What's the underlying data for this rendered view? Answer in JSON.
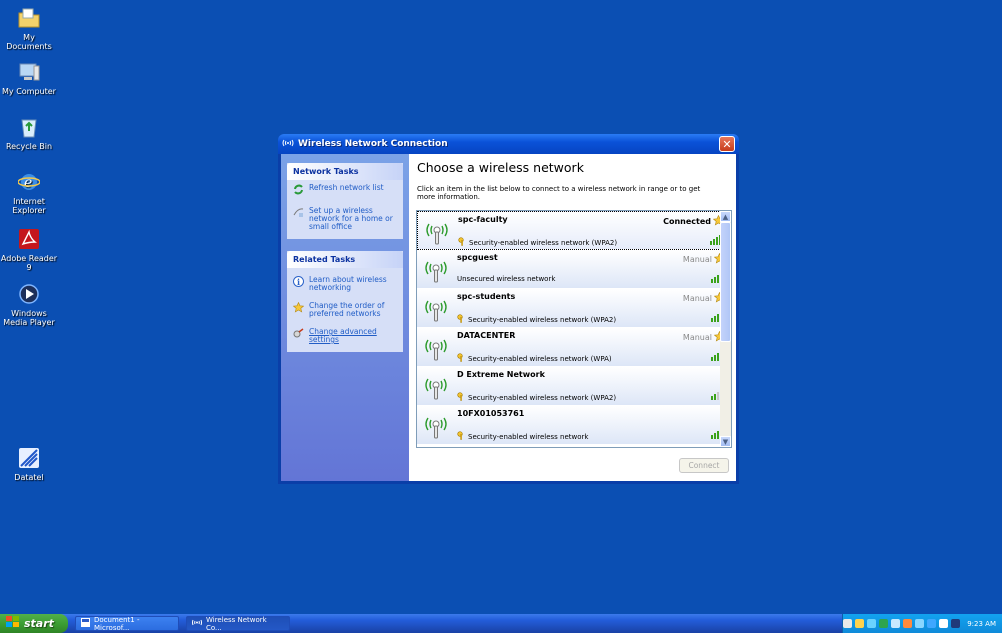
{
  "desktop": {
    "icons": [
      {
        "label": "My Documents",
        "icon": "my-documents-icon"
      },
      {
        "label": "My Computer",
        "icon": "my-computer-icon"
      },
      {
        "label": "Recycle Bin",
        "icon": "recycle-bin-icon"
      },
      {
        "label": "Internet Explorer",
        "icon": "internet-explorer-icon"
      },
      {
        "label": "Adobe Reader 9",
        "icon": "adobe-reader-icon"
      },
      {
        "label": "Windows Media Player",
        "icon": "media-player-icon"
      },
      {
        "label": "Datatel",
        "icon": "datatel-icon"
      }
    ]
  },
  "window": {
    "title": "Wireless Network Connection",
    "close_label": "✕"
  },
  "network_tasks": {
    "heading": "Network Tasks",
    "items": [
      {
        "label": "Refresh network list",
        "icon": "refresh-icon"
      },
      {
        "label": "Set up a wireless network for a home or small office",
        "icon": "setup-network-icon"
      }
    ]
  },
  "related_tasks": {
    "heading": "Related Tasks",
    "items": [
      {
        "label": "Learn about wireless networking",
        "icon": "info-icon"
      },
      {
        "label": "Change the order of preferred networks",
        "icon": "star-icon"
      },
      {
        "label": "Change advanced settings",
        "icon": "settings-icon"
      }
    ]
  },
  "main": {
    "heading": "Choose a wireless network",
    "instructions": "Click an item in the list below to connect to a wireless network in range or to get more information.",
    "connect_label": "Connect"
  },
  "networks": [
    {
      "ssid": "spc-faculty",
      "security": "Security-enabled wireless network (WPA2)",
      "status": "Connected",
      "secured": true,
      "signal": 5
    },
    {
      "ssid": "spcguest",
      "security": "Unsecured wireless network",
      "status": "Manual",
      "secured": false,
      "signal": 5
    },
    {
      "ssid": "spc-students",
      "security": "Security-enabled wireless network (WPA2)",
      "status": "Manual",
      "secured": true,
      "signal": 5
    },
    {
      "ssid": "DATACENTER",
      "security": "Security-enabled wireless network (WPA)",
      "status": "Manual",
      "secured": true,
      "signal": 5
    },
    {
      "ssid": "D Extreme Network",
      "security": "Security-enabled wireless network (WPA2)",
      "status": "",
      "secured": true,
      "signal": 2
    },
    {
      "ssid": "10FX01053761",
      "security": "Security-enabled wireless network",
      "status": "",
      "secured": true,
      "signal": 5
    }
  ],
  "taskbar": {
    "start_label": "start",
    "buttons": [
      {
        "label": "Document1 - Microsof...",
        "icon": "word-document-icon"
      },
      {
        "label": "Wireless Network Co...",
        "icon": "wireless-icon"
      }
    ],
    "clock": "9:23 AM"
  },
  "colors": {
    "desktop_bg": "#0b4fb3",
    "signal_on": "#3aa21b",
    "link": "#215dc6"
  }
}
